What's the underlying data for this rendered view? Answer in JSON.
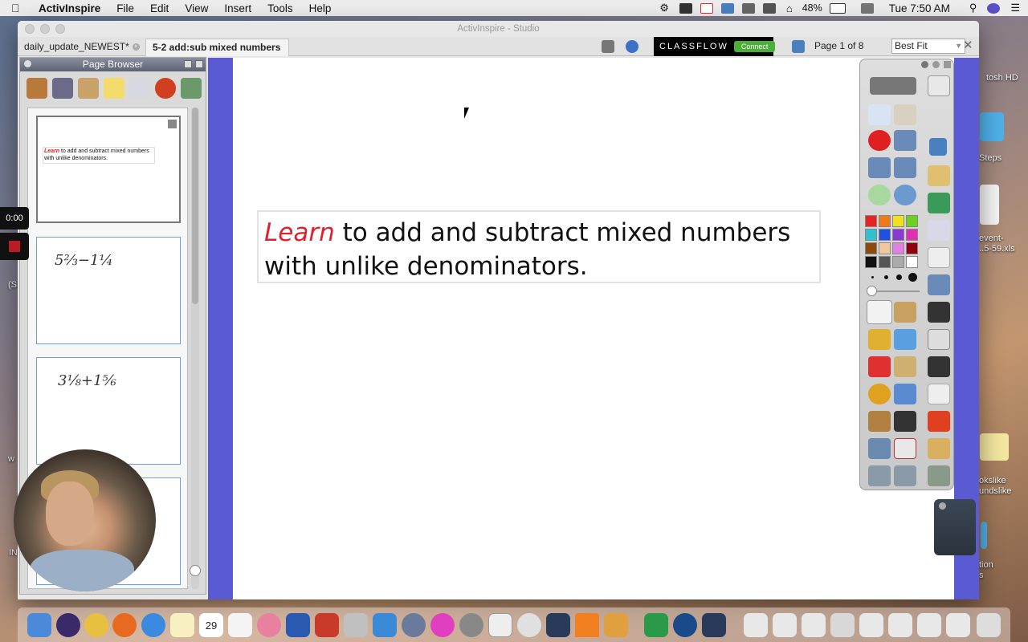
{
  "menubar": {
    "app": "ActivInspire",
    "items": [
      "File",
      "Edit",
      "View",
      "Insert",
      "Tools",
      "Help"
    ],
    "battery": "48%",
    "clock": "Tue 7:50 AM"
  },
  "desktop": {
    "labels": [
      "tosh HD",
      "Steps",
      "event-",
      "..5-59.xls",
      "okslike",
      "undslike",
      "tion",
      "s",
      "w",
      "IN",
      "(S"
    ]
  },
  "window": {
    "title": "ActivInspire - Studio",
    "tabs": [
      "daily_update_NEWEST*",
      "5-2 add:sub mixed numbers"
    ],
    "classflow": {
      "brand": "CLASSFLOW",
      "connect": "Connect"
    },
    "page_info": "Page 1 of 8",
    "zoom": "Best Fit"
  },
  "page_browser": {
    "title": "Page Browser",
    "thumb1_lead": "Learn",
    "thumb1_text": " to add and subtract mixed numbers with unlike denominators.",
    "thumb2_expr": "5⅔−1¼",
    "thumb3_expr": "3⅛+1⅚"
  },
  "canvas": {
    "lead": "Learn",
    "text": " to add and subtract mixed numbers with unlike denominators."
  },
  "recording": {
    "timer": "0:00"
  },
  "dock": {
    "calendar_day": "29"
  },
  "palette": [
    "#e52424",
    "#f07a1a",
    "#f0e020",
    "#6cd020",
    "#30c0d0",
    "#2050e0",
    "#8a3ad0",
    "#e030b0",
    "#8a4a10",
    "#f0c8a0",
    "#e080e0",
    "#900010",
    "#111111",
    "#555555",
    "#aaaaaa",
    "#ffffff"
  ]
}
